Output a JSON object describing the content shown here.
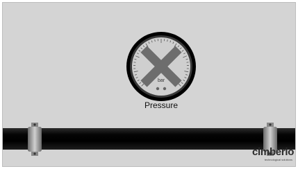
{
  "gauge": {
    "label": "Pressure",
    "unit": "bar",
    "status_icon": "x-disabled-icon",
    "colors": {
      "bezel": "#000000",
      "dial": "#cfcfcf",
      "x_mark": "#6d6d6d"
    }
  },
  "pipe": {
    "color": "#000000",
    "clamps": [
      "left-clamp",
      "right-clamp"
    ]
  },
  "brand": {
    "name": "cimberio",
    "tagline": "technological solutions"
  }
}
